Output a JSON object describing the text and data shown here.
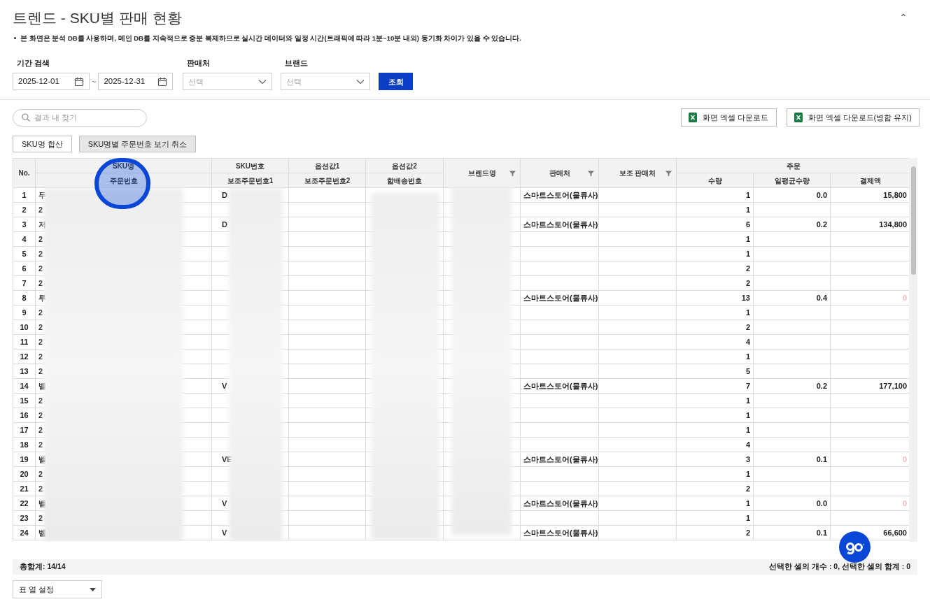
{
  "page": {
    "title": "트렌드 - SKU별 판매 현황",
    "collapse_icon": "⌃",
    "notice": "본 화면은 분석 DB를 사용하며, 메인 DB를 지속적으로 증분 복제하므로 실시간 데이터와 일정 시간(트래픽에 따라 1분~10분 내외) 동기화 차이가 있을 수 있습니다."
  },
  "filters": {
    "period_label": "기간 검색",
    "start_date": "2025-12-01",
    "separator": "~",
    "end_date": "2025-12-31",
    "store_label": "판매처",
    "store_placeholder": "선택",
    "brand_label": "브랜드",
    "brand_placeholder": "선택",
    "search_button": "조회"
  },
  "toolbar": {
    "search_placeholder": "결과 내 찾기",
    "excel_buttons": [
      "화면 엑셀 다운로드",
      "화면 엑셀 다운로드(병합 유지)"
    ],
    "view_buttons": [
      {
        "label": "SKU명 합산",
        "selected": false
      },
      {
        "label": "SKU명별 주문번호 보기 취소",
        "selected": true
      }
    ]
  },
  "table": {
    "no_label": "No.",
    "columns": [
      {
        "label": "SKU명",
        "sub": "주문번호",
        "filter": false
      },
      {
        "label": "SKU번호",
        "sub": "보조주문번호1",
        "filter": false
      },
      {
        "label": "옵션값1",
        "sub": "보조주문번호2",
        "filter": false
      },
      {
        "label": "옵션값2",
        "sub": "합배송번호",
        "filter": false
      },
      {
        "label": "브랜드명",
        "filter": true
      },
      {
        "label": "판매처",
        "filter": true
      },
      {
        "label": "보조 판매처",
        "filter": true
      }
    ],
    "group": {
      "label": "주문",
      "columns": [
        "수량",
        "일평균수량",
        "결제액"
      ]
    },
    "rows": [
      {
        "no": "1",
        "sku_name": "두",
        "sku_no": "D",
        "store": "스마트스토어(물류사)",
        "qty": "1",
        "avg": "0.0",
        "amount": "15,800",
        "amount_muted": false
      },
      {
        "no": "2",
        "sku_name": "2",
        "qty": "1"
      },
      {
        "no": "3",
        "sku_name": "저",
        "sku_no": "D",
        "store": "스마트스토어(물류사)",
        "qty": "6",
        "avg": "0.2",
        "amount": "134,800",
        "amount_muted": false
      },
      {
        "no": "4",
        "sku_name": "2",
        "qty": "1"
      },
      {
        "no": "5",
        "sku_name": "2",
        "qty": "1"
      },
      {
        "no": "6",
        "sku_name": "2",
        "qty": "2"
      },
      {
        "no": "7",
        "sku_name": "2",
        "qty": "2"
      },
      {
        "no": "8",
        "sku_name": "루",
        "store": "스마트스토어(물류사)",
        "qty": "13",
        "avg": "0.4",
        "amount": "0",
        "amount_muted": true
      },
      {
        "no": "9",
        "sku_name": "2",
        "qty": "1"
      },
      {
        "no": "10",
        "sku_name": "2",
        "qty": "2"
      },
      {
        "no": "11",
        "sku_name": "2",
        "qty": "4"
      },
      {
        "no": "12",
        "sku_name": "2",
        "qty": "1"
      },
      {
        "no": "13",
        "sku_name": "2",
        "qty": "5"
      },
      {
        "no": "14",
        "sku_name": "벨",
        "sku_no": "V",
        "store": "스마트스토어(물류사)",
        "qty": "7",
        "avg": "0.2",
        "amount": "177,100",
        "amount_muted": false
      },
      {
        "no": "15",
        "sku_name": "2",
        "qty": "1"
      },
      {
        "no": "16",
        "sku_name": "2",
        "qty": "1"
      },
      {
        "no": "17",
        "sku_name": "2",
        "qty": "1"
      },
      {
        "no": "18",
        "sku_name": "2",
        "qty": "4"
      },
      {
        "no": "19",
        "sku_name": "벨",
        "sku_no": "VE",
        "store": "스마트스토어(물류사)",
        "qty": "3",
        "avg": "0.1",
        "amount": "0",
        "amount_muted": true
      },
      {
        "no": "20",
        "sku_name": "2",
        "qty": "1"
      },
      {
        "no": "21",
        "sku_name": "2",
        "qty": "2"
      },
      {
        "no": "22",
        "sku_name": "벨",
        "sku_no": "V",
        "store": "스마트스토어(물류사)",
        "qty": "1",
        "avg": "0.0",
        "amount": "0",
        "amount_muted": true
      },
      {
        "no": "23",
        "sku_name": "2",
        "qty": "1"
      },
      {
        "no": "24",
        "sku_name": "벨",
        "sku_no": "V",
        "store": "스마트스토어(물류사)",
        "qty": "2",
        "avg": "0.1",
        "amount": "66,600",
        "amount_muted": false
      }
    ]
  },
  "footer": {
    "total": "총합계: 14/14",
    "selection": "선택한 셀의 개수 : 0, 선택한 셀의 합계 : 0",
    "column_settings": "표 열 설정"
  }
}
